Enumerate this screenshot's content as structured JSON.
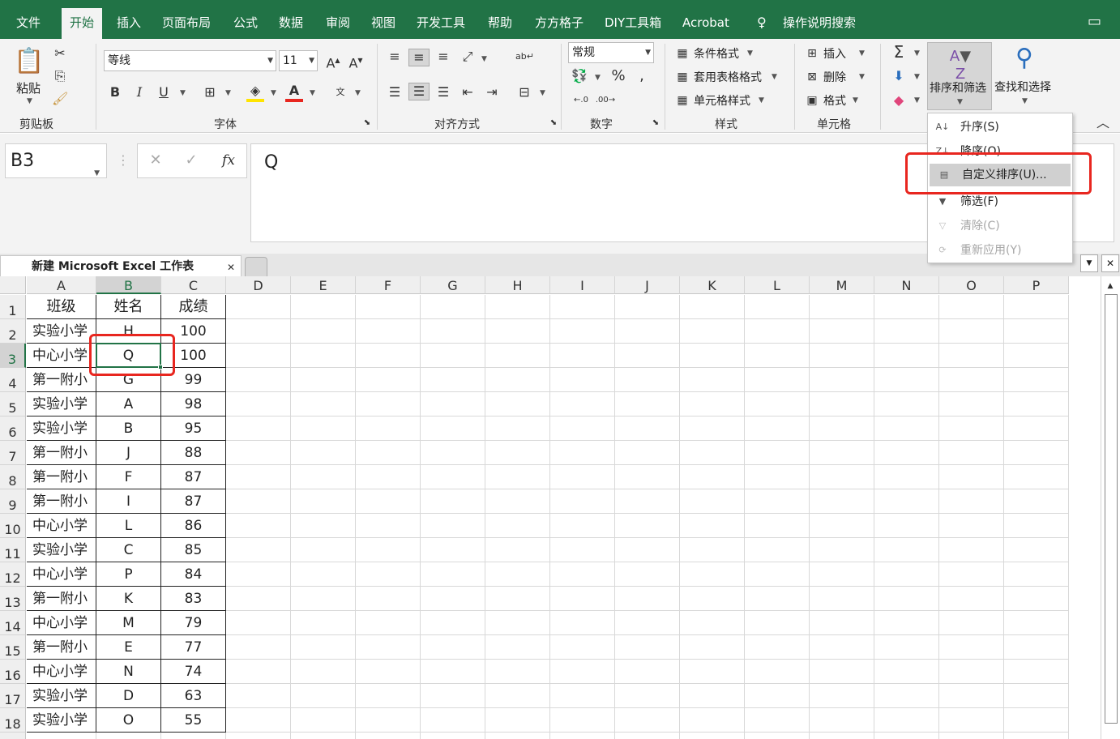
{
  "menu": {
    "tabs": [
      "文件",
      "开始",
      "插入",
      "页面布局",
      "公式",
      "数据",
      "审阅",
      "视图",
      "开发工具",
      "帮助",
      "方方格子",
      "DIY工具箱",
      "Acrobat"
    ],
    "active": "开始",
    "search": "操作说明搜索"
  },
  "ribbon": {
    "clipboard": {
      "label": "剪贴板",
      "paste": "粘贴"
    },
    "font": {
      "label": "字体",
      "name": "等线",
      "size": "11",
      "bold": "B",
      "italic": "I",
      "underline": "U",
      "color_accent": "#e8261f",
      "highlight": "#ffe400"
    },
    "alignment": {
      "label": "对齐方式"
    },
    "number": {
      "label": "数字",
      "format": "常规"
    },
    "styles": {
      "label": "样式",
      "conditional": "条件格式",
      "table": "套用表格格式",
      "cell": "单元格样式"
    },
    "cells": {
      "label": "单元格",
      "insert": "插入",
      "delete": "删除",
      "format": "格式"
    },
    "editing": {
      "sort_filter": "排序和筛选",
      "find_select": "查找和选择"
    }
  },
  "sort_menu": {
    "items": [
      {
        "label": "升序(S)",
        "icon": "sort-ascending-icon",
        "enabled": true
      },
      {
        "label": "降序(O)",
        "icon": "sort-descending-icon",
        "enabled": true
      },
      {
        "label": "自定义排序(U)...",
        "icon": "custom-sort-icon",
        "enabled": true,
        "highlighted": true
      },
      {
        "label": "筛选(F)",
        "icon": "filter-icon",
        "enabled": true
      },
      {
        "label": "清除(C)",
        "icon": "clear-filter-icon",
        "enabled": false
      },
      {
        "label": "重新应用(Y)",
        "icon": "reapply-icon",
        "enabled": false
      }
    ]
  },
  "formula_bar": {
    "name_box": "B3",
    "value": "Q",
    "fx": "fx"
  },
  "workbook": {
    "tab_title": "新建 Microsoft Excel 工作表"
  },
  "sheet": {
    "columns": [
      "A",
      "B",
      "C",
      "D",
      "E",
      "F",
      "G",
      "H",
      "I",
      "J",
      "K",
      "L",
      "M",
      "N",
      "O",
      "P"
    ],
    "selected_cell": "B3",
    "headers": [
      "班级",
      "姓名",
      "成绩"
    ],
    "rows": [
      [
        "实验小学",
        "H",
        "100"
      ],
      [
        "中心小学",
        "Q",
        "100"
      ],
      [
        "第一附小",
        "G",
        "99"
      ],
      [
        "实验小学",
        "A",
        "98"
      ],
      [
        "实验小学",
        "B",
        "95"
      ],
      [
        "第一附小",
        "J",
        "88"
      ],
      [
        "第一附小",
        "F",
        "87"
      ],
      [
        "第一附小",
        "I",
        "87"
      ],
      [
        "中心小学",
        "L",
        "86"
      ],
      [
        "实验小学",
        "C",
        "85"
      ],
      [
        "中心小学",
        "P",
        "84"
      ],
      [
        "第一附小",
        "K",
        "83"
      ],
      [
        "中心小学",
        "M",
        "79"
      ],
      [
        "第一附小",
        "E",
        "77"
      ],
      [
        "中心小学",
        "N",
        "74"
      ],
      [
        "实验小学",
        "D",
        "63"
      ],
      [
        "实验小学",
        "O",
        "55"
      ]
    ]
  },
  "colors": {
    "excel_green": "#217346",
    "highlight_red": "#e8261f"
  }
}
